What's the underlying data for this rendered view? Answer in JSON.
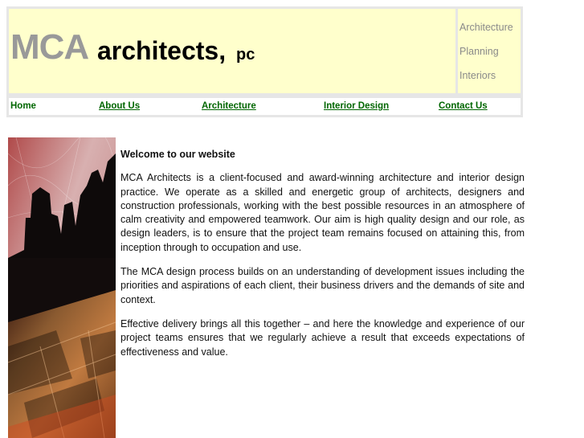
{
  "brand": {
    "name_part1": "MCA",
    "name_part2": "architects,",
    "name_part3": "pc"
  },
  "side_menu": [
    "Architecture",
    "Planning",
    "Interiors"
  ],
  "nav": [
    "Home",
    "About Us",
    "Architecture",
    "Interior Design",
    "Contact Us"
  ],
  "colors": {
    "header_bg": "#ffffcc",
    "nav_link": "#006600",
    "logo_gray": "#999999",
    "frame": "#e6e6e6"
  },
  "content": {
    "heading": "Welcome to our website",
    "paragraphs": [
      "MCA Architects is a client-focused and award-winning architecture and interior design practice. We operate as a skilled and energetic group of architects, designers and construction professionals, working with the best possible resources in an atmosphere of calm creativity and empowered teamwork. Our aim is high quality design and our role, as design leaders, is to ensure that the project team remains focused on attaining this, from inception through to occupation and use.",
      "The MCA design process builds on an understanding of development issues including the priorities and aspirations of each client, their business drivers and the demands of site and context.",
      "Effective delivery brings all this together – and here the knowledge and experience of our project teams ensures that we regularly achieve a result that exceeds expectations of effectiveness and value."
    ]
  }
}
